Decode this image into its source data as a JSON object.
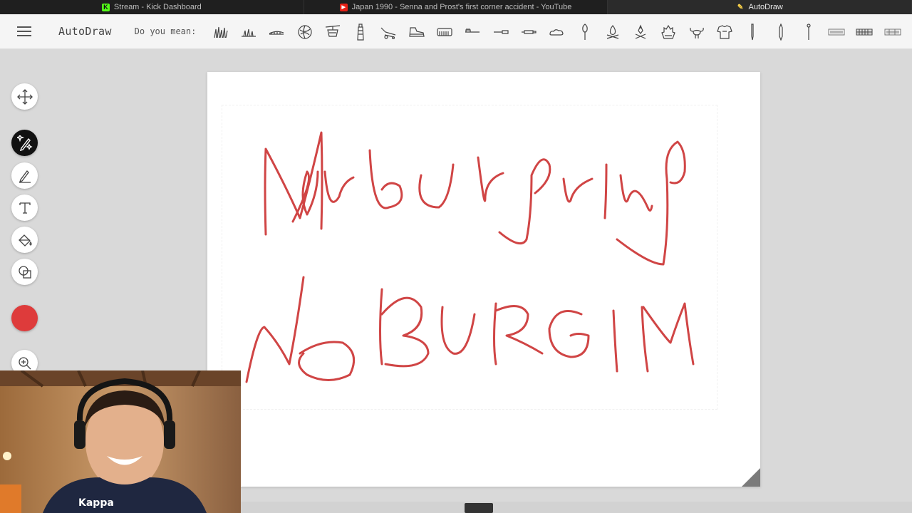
{
  "tabs": [
    {
      "title": "Stream - Kick Dashboard",
      "favicon": "kick-icon",
      "active": false
    },
    {
      "title": "Japan 1990 - Senna and Prost's first corner accident - YouTube",
      "favicon": "youtube-icon",
      "active": false
    },
    {
      "title": "AutoDraw",
      "favicon": "autodraw-icon",
      "active": true
    }
  ],
  "header": {
    "brand": "AutoDraw",
    "did_you_mean": "Do you mean:",
    "suggestions": [
      "grass-icon",
      "grass-short-icon",
      "caterpillar-icon",
      "globe-icon",
      "gondola-icon",
      "lighthouse-icon",
      "skateboard-icon",
      "shoe-icon",
      "comb-icon",
      "toothbrush-icon",
      "knife-icon",
      "marker-icon",
      "cloud-icon",
      "paintbrush-icon",
      "campfire-icon",
      "campfire-2-icon",
      "fire-icon",
      "crab-icon",
      "shirt-icon",
      "pencil-icon",
      "crayon-icon",
      "pin-icon",
      "keyboard-icon",
      "keyboard-2-icon",
      "keyboard-3-icon"
    ]
  },
  "toolbar": {
    "tools": [
      "move-tool",
      "autodraw-tool",
      "draw-tool",
      "type-tool",
      "fill-tool",
      "shape-tool"
    ],
    "active_tool": "autodraw-tool",
    "current_color": "#de3b3b",
    "zoom": "zoom-tool"
  },
  "canvas": {
    "stroke_color": "#d04545",
    "drawn_text_line1": "Nurburgring",
    "drawn_text_line2": "NOBURGIM"
  },
  "colors": {
    "accent": "#de3b3b",
    "ink": "#d04545"
  }
}
